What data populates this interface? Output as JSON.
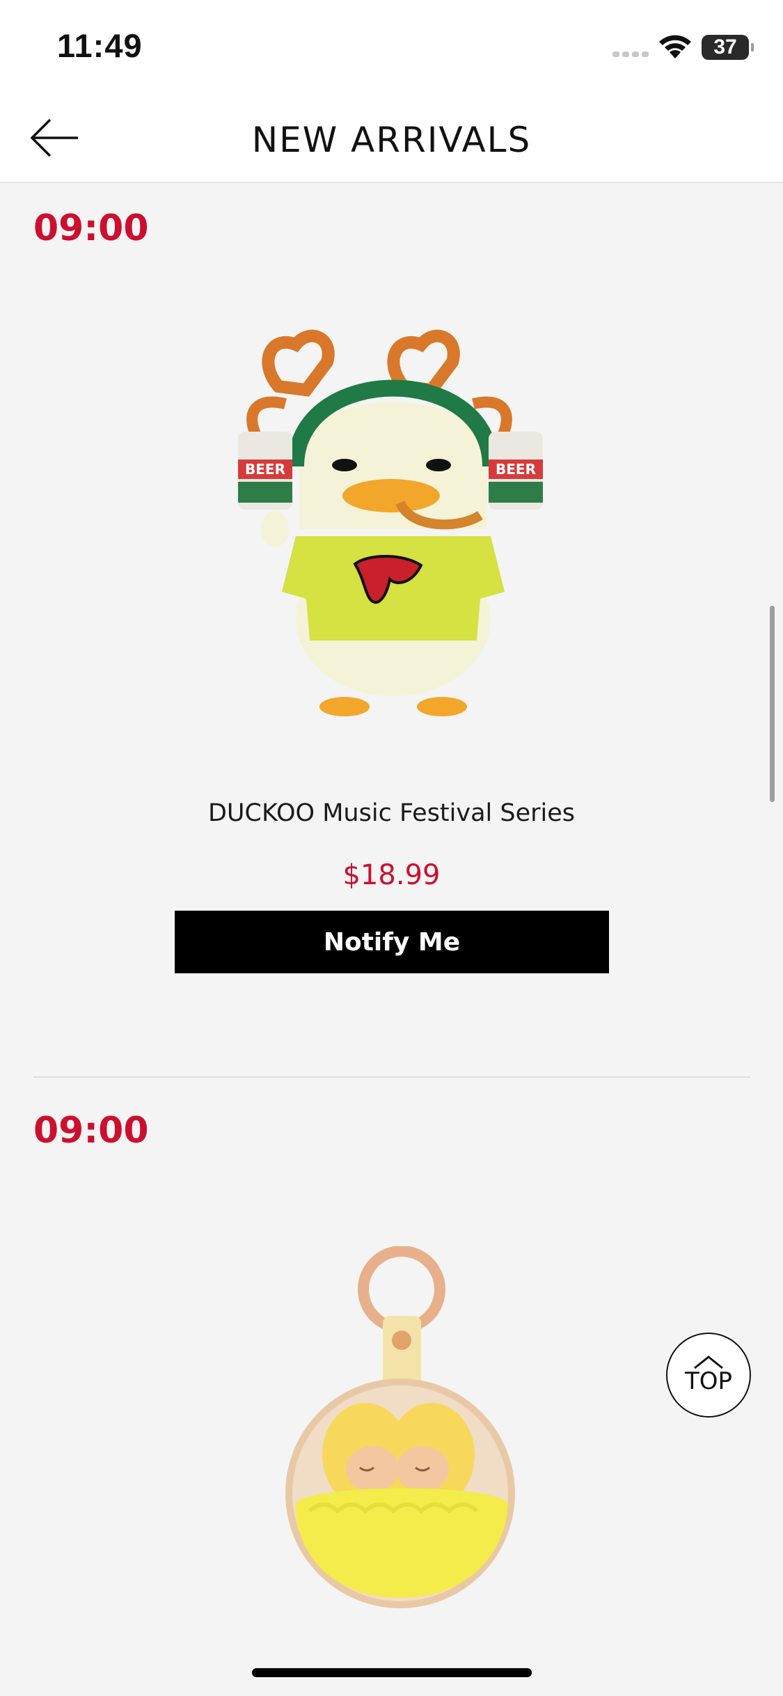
{
  "status_bar": {
    "time": "11:49",
    "battery_level": "37",
    "icons": [
      "cellular-signal-icon",
      "wifi-icon",
      "battery-icon"
    ]
  },
  "nav": {
    "title": "NEW ARRIVALS",
    "back_icon": "arrow-left-icon"
  },
  "products": [
    {
      "release_time": "09:00",
      "name": "DUCKOO Music Festival Series",
      "price": "$18.99",
      "button_label": "Notify Me"
    },
    {
      "release_time": "09:00"
    }
  ],
  "top_button": {
    "label": "TOP",
    "icon": "chevron-up-icon"
  },
  "colors": {
    "accent_red": "#cc0f2e",
    "button_black": "#000000",
    "background": "#f4f4f4"
  }
}
